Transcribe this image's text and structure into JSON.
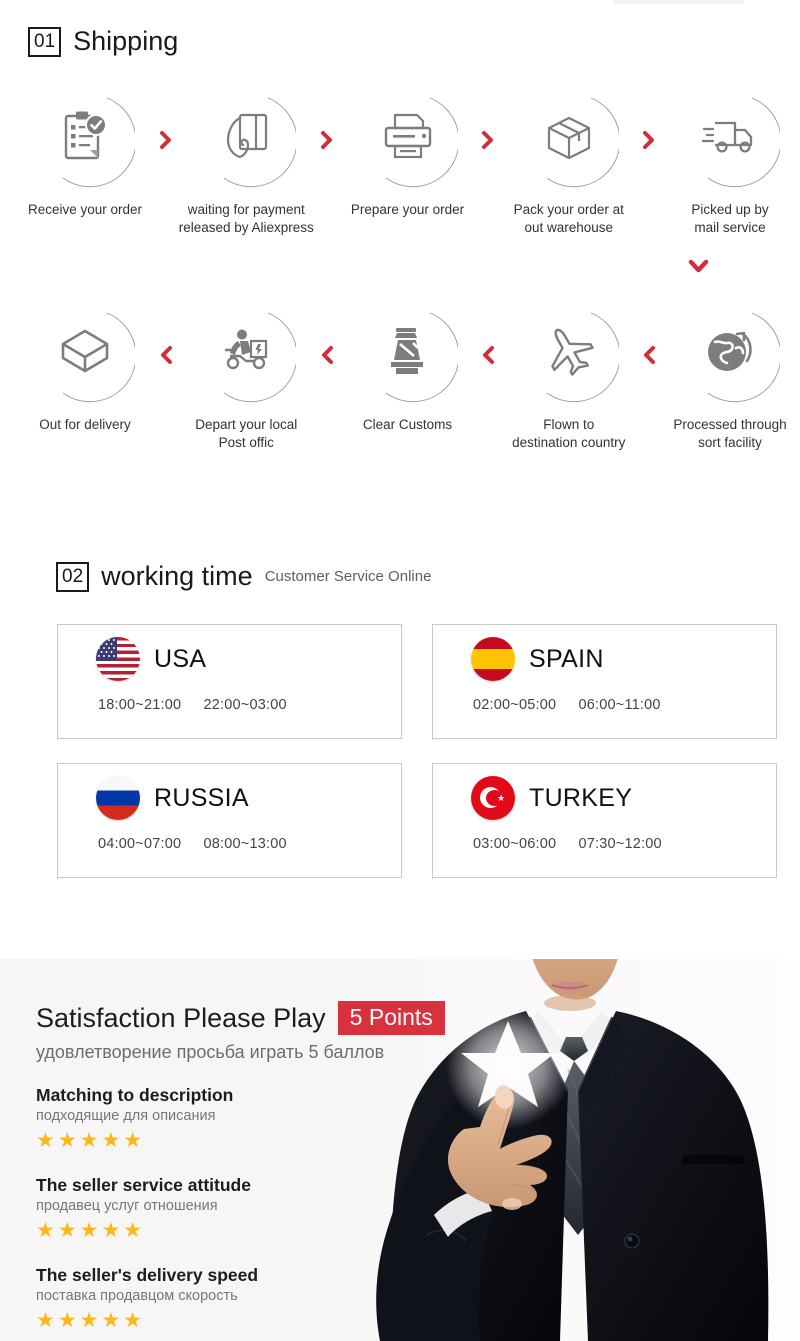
{
  "shipping": {
    "number": "01",
    "title": "Shipping",
    "row1": [
      {
        "label": "Receive your order",
        "icon": "clipboard-check-icon"
      },
      {
        "label": "waiting for payment released by Aliexpress",
        "icon": "hand-card-icon"
      },
      {
        "label": "Prepare your order",
        "icon": "printer-icon"
      },
      {
        "label": "Pack your order at out warehouse",
        "icon": "box-closed-icon"
      },
      {
        "label": "Picked up by mail service",
        "icon": "delivery-truck-icon"
      }
    ],
    "row2": [
      {
        "label": "Out  for delivery",
        "icon": "box-open-icon"
      },
      {
        "label": "Depart your local Post offic",
        "icon": "scooter-courier-icon"
      },
      {
        "label": "Clear Customs",
        "icon": "customs-officer-icon"
      },
      {
        "label": "Flown to destination country",
        "icon": "airplane-icon"
      },
      {
        "label": "Processed through sort facility",
        "icon": "globe-arrow-icon"
      }
    ],
    "arrow_right": "chevron-right-icon",
    "arrow_left": "chevron-left-icon",
    "arrow_down": "chevron-down-icon",
    "arrow_color": "#cf2e3a"
  },
  "working_time": {
    "number": "02",
    "title": "working time",
    "subtitle": "Customer Service Online",
    "cards": [
      {
        "country": "USA",
        "flag": "flag-usa-icon",
        "hours": [
          "18:00~21:00",
          "22:00~03:00"
        ]
      },
      {
        "country": "SPAIN",
        "flag": "flag-spain-icon",
        "hours": [
          "02:00~05:00",
          "06:00~11:00"
        ]
      },
      {
        "country": "RUSSIA",
        "flag": "flag-russia-icon",
        "hours": [
          "04:00~07:00",
          "08:00~13:00"
        ]
      },
      {
        "country": "TURKEY",
        "flag": "flag-turkey-icon",
        "hours": [
          "03:00~06:00",
          "07:30~12:00"
        ]
      }
    ]
  },
  "satisfaction": {
    "title": "Satisfaction Please Play",
    "badge": "5 Points",
    "badge_color": "#d8323f",
    "subtitle": "удовлетворение просьба играть 5 баллов",
    "star_color": "#fcb71b",
    "ratings": [
      {
        "en": "Matching to description",
        "ru": "подходящие для описания",
        "stars": "★★★★★"
      },
      {
        "en": "The seller service attitude",
        "ru": "продавец услуг отношения",
        "stars": "★★★★★"
      },
      {
        "en": "The seller's delivery speed",
        "ru": "поставка продавцом скорость",
        "stars": "★★★★★"
      }
    ]
  }
}
